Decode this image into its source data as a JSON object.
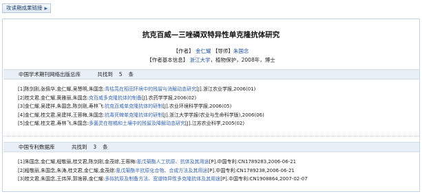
{
  "toolbar": {
    "quick_link_label": "攻读期成果链接"
  },
  "paper": {
    "title": "抗克百威—三唑磷双特异性单克隆抗体研究",
    "author_label": "【作者】",
    "author": "金仁耀",
    "advisor_label": "【导师】",
    "advisor": "朱国念",
    "info_label": "【作者基本信息】",
    "school": "浙江大学",
    "info_rest": "，植物保护，2008年，博士"
  },
  "journal_section": {
    "db_name": "中国学术期刊网络出版总库",
    "count_label": "共找到",
    "count": "5",
    "count_unit": "条",
    "items": [
      {
        "prefix": "[1]陈剑刚,张佩华,金仁耀,吴慧明,朱国念:",
        "title": "青枯芫在稻田环境中的残留与消解动态研究",
        "suffix": "[J].浙江农业学报,2006(01)"
      },
      {
        "prefix": "[2]桂文君,金仁耀,黄雅丽,朱国念:",
        "title": "克百威多克隆抗体的制备",
        "suffix": "[J].农药学学报,2006(02)"
      },
      {
        "prefix": "[3]金仁耀,吴建祥,朱国念,陈剑刚,寿林飞:",
        "title": "抗克百威单克隆抗体的研制",
        "suffix": "[J].农业环境科学学报,2006(05)"
      },
      {
        "prefix": "[4]金仁耀,桂文君,吴建祥,王蓉梅,朱国念:",
        "title": "抗毒死蜱单克隆抗体的研制",
        "suffix": "[J].浙江大学学报(农业与生命科学版),2006(06)"
      },
      {
        "prefix": "[5]金仁耀,桂文君,寿林飞,朱国念:",
        "title": "多菌灵在柑橘和土壤中的残留及降解动态研究",
        "suffix": "[J].江苏农业科学,2005(02)"
      }
    ]
  },
  "patent_section": {
    "db_name": "中国专利数据库",
    "count_label": "共找到",
    "count": "3",
    "count_unit": "条",
    "items": [
      {
        "prefix": "[1]朱国念,金仁耀,程敬丽,桂文君,陈剑刚,金茂综,王蓉梅:",
        "title": "氰戊菊酯人工抗原、抗体及其用途",
        "suffix": "[P].中国专利:CN1789283,2006-06-21"
      },
      {
        "prefix": "[2]程敬丽,朱国念,朱涛,桂文君,金仁耀,金茂综:",
        "title": "氰戊菊酯半抗原化合物、合成方法及其用途",
        "suffix": "[P].中国专利:CN1789238,2006-06-21"
      },
      {
        "prefix": "[3]桂文君,朱国念,王炜萍,郭逸蓉,金仁耀:",
        "title": "多拟抗原及制备方法、宽谱特异性多克隆抗体及其用途",
        "suffix": "[P].中国专利:CN1908864,2007-02-07"
      }
    ]
  },
  "colors": {
    "link": "#1f4fa3",
    "section_bg": "#e9eff7",
    "border": "#c5d2e2"
  }
}
